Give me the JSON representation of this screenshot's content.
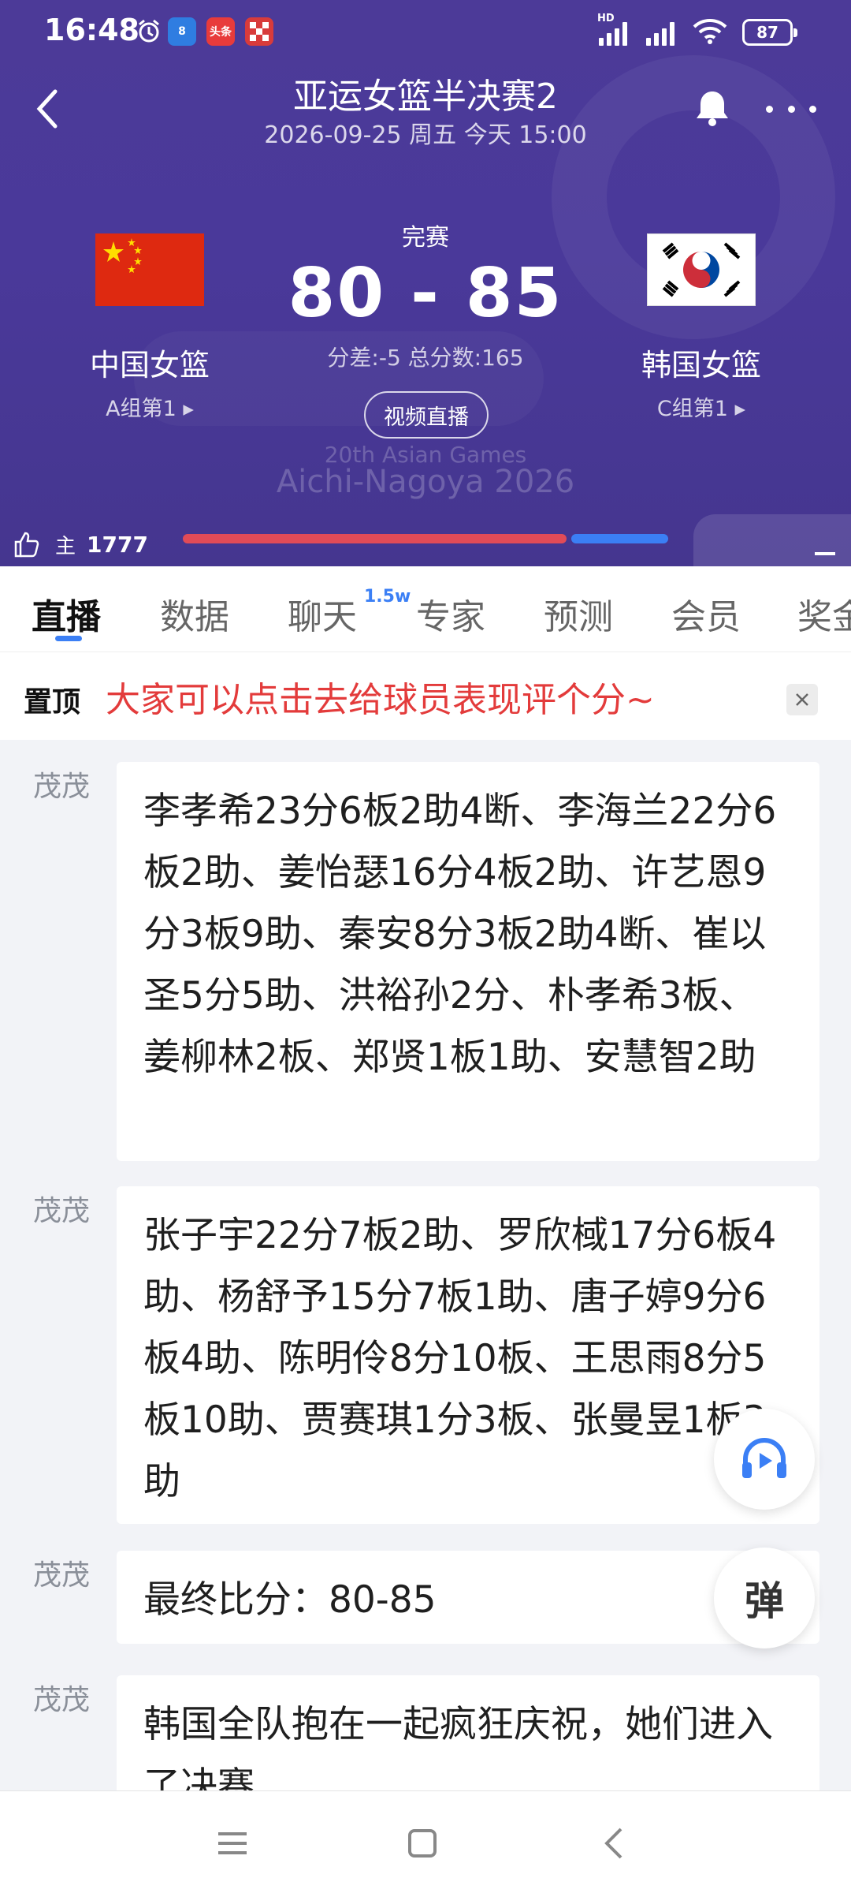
{
  "status_bar": {
    "time": "16:48",
    "net_label": "HD",
    "battery": "87",
    "app_badges": [
      {
        "name": "browser-badge",
        "text": "8",
        "color": "#2f7de1"
      },
      {
        "name": "toutiao-badge",
        "text": "头条",
        "color": "#e83b3b"
      },
      {
        "name": "game-badge",
        "text": "",
        "color": "#d83b3b"
      }
    ]
  },
  "header": {
    "title": "亚运女篮半决赛2",
    "subtitle": "2026-09-25 周五 今天 15:00",
    "match_status": "完赛",
    "score": "80 - 85",
    "score_meta": "分差:-5 总分数:165",
    "video_button": "视频直播",
    "watermark_line1": "20th Asian Games",
    "watermark_line2": "Aichi-Nagoya 2026",
    "home_team": {
      "name": "中国女篮",
      "group": "A组第1 ▸"
    },
    "away_team": {
      "name": "韩国女篮",
      "group": "C组第1 ▸"
    },
    "support": {
      "label": "主",
      "count": "1777",
      "home_share": 0.79,
      "home_color": "#e14b57",
      "away_color": "#3b7ff5"
    }
  },
  "tabs": {
    "items": [
      "直播",
      "数据",
      "聊天",
      "专家",
      "预测",
      "会员",
      "奖金"
    ],
    "chat_badge": "1.5w",
    "active": "直播"
  },
  "pinned": {
    "tag": "置顶",
    "text": "大家可以点击去给球员表现评个分~"
  },
  "feed": {
    "messages": [
      {
        "author": "茂茂",
        "text": "李孝希23分6板2助4断、李海兰22分6板2助、姜怡瑟16分4板2助、许艺恩9分3板9助、秦安8分3板2助4断、崔以圣5分5助、洪裕孙2分、朴孝希3板、姜柳林2板、郑贤1板1助、安慧智2助"
      },
      {
        "author": "茂茂",
        "text": "张子宇22分7板2助、罗欣棫17分6板4助、杨舒予15分7板1助、唐子婷9分6板4助、陈明伶8分10板、王思雨8分5板10助、贾赛琪1分3板、张曼昱1板3助"
      },
      {
        "author": "茂茂",
        "text": "最终比分：80-85"
      },
      {
        "author": "茂茂",
        "text": "韩国全队抱在一起疯狂庆祝，她们进入了决赛"
      }
    ],
    "fab_danmu": "弹"
  },
  "colors": {
    "header_bg": "#4a399a",
    "accent": "#3b7ff5",
    "pin_text": "#e33b3b",
    "feed_bg": "#f2f3f7"
  }
}
